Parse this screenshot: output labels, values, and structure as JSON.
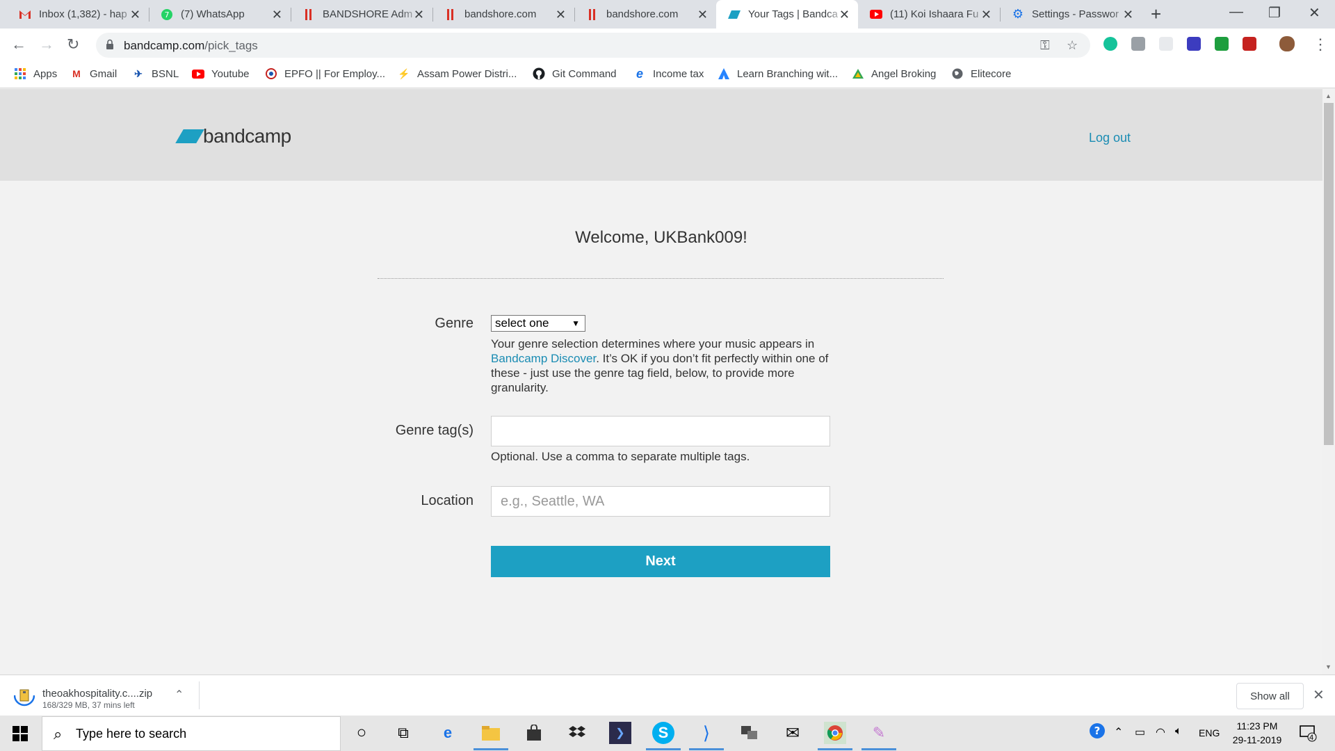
{
  "browser": {
    "tabs": [
      {
        "title": "Inbox (1,382) - hap",
        "icon": "gmail-icon",
        "color": "#d93025"
      },
      {
        "title": "(7) WhatsApp",
        "icon": "whatsapp-icon",
        "color": "#25d366"
      },
      {
        "title": "BANDSHORE Adm",
        "icon": "bandshore-icon",
        "color": "#d93025"
      },
      {
        "title": "bandshore.com",
        "icon": "bandshore-icon",
        "color": "#d93025"
      },
      {
        "title": "bandshore.com",
        "icon": "bandshore-icon",
        "color": "#d93025"
      },
      {
        "title": "Your Tags | Bandca",
        "icon": "bandcamp-icon",
        "color": "#1da0c3",
        "active": true
      },
      {
        "title": "(11) Koi Ishaara Fu",
        "icon": "youtube-icon",
        "color": "#ff0000"
      },
      {
        "title": "Settings - Passwor",
        "icon": "gear-icon",
        "color": "#1a73e8"
      }
    ],
    "url_host": "bandcamp.com",
    "url_path": "/pick_tags",
    "bookmarks": [
      {
        "label": "Apps",
        "icon": "apps-grid-icon"
      },
      {
        "label": "Gmail",
        "icon": "gmail-icon"
      },
      {
        "label": "BSNL",
        "icon": "bsnl-icon"
      },
      {
        "label": "Youtube",
        "icon": "youtube-icon"
      },
      {
        "label": "EPFO || For Employ...",
        "icon": "epfo-icon"
      },
      {
        "label": "Assam Power Distri...",
        "icon": "apdcl-icon"
      },
      {
        "label": "Git Command",
        "icon": "github-icon"
      },
      {
        "label": "Income tax",
        "icon": "edge-e-icon"
      },
      {
        "label": "Learn Branching wit...",
        "icon": "atlassian-icon"
      },
      {
        "label": "Angel Broking",
        "icon": "angel-icon"
      },
      {
        "label": "Elitecore",
        "icon": "globe-icon"
      }
    ]
  },
  "page": {
    "logo_text": "bandcamp",
    "logout": "Log out",
    "welcome": "Welcome, UKBank009!",
    "genre_label": "Genre",
    "genre_selected": "select one",
    "help_before": "Your genre selection determines where your music appears in ",
    "help_link": "Bandcamp Discover",
    "help_after": ". It’s OK if you don’t fit perfectly within one of these - just use the genre tag field, below, to provide more granularity.",
    "tags_label": "Genre tag(s)",
    "tags_value": "",
    "tags_hint": "Optional. Use a comma to separate multiple tags.",
    "location_label": "Location",
    "location_placeholder": "e.g., Seattle, WA",
    "next_label": "Next",
    "accent_color": "#1da0c3"
  },
  "downloads": {
    "file_name": "theoakhospitality.c....zip",
    "status": "168/329 MB, 37 mins left",
    "show_all": "Show all"
  },
  "taskbar": {
    "search_placeholder": "Type here to search",
    "language": "ENG",
    "time": "11:23 PM",
    "date": "29-11-2019",
    "notifications": "4"
  }
}
